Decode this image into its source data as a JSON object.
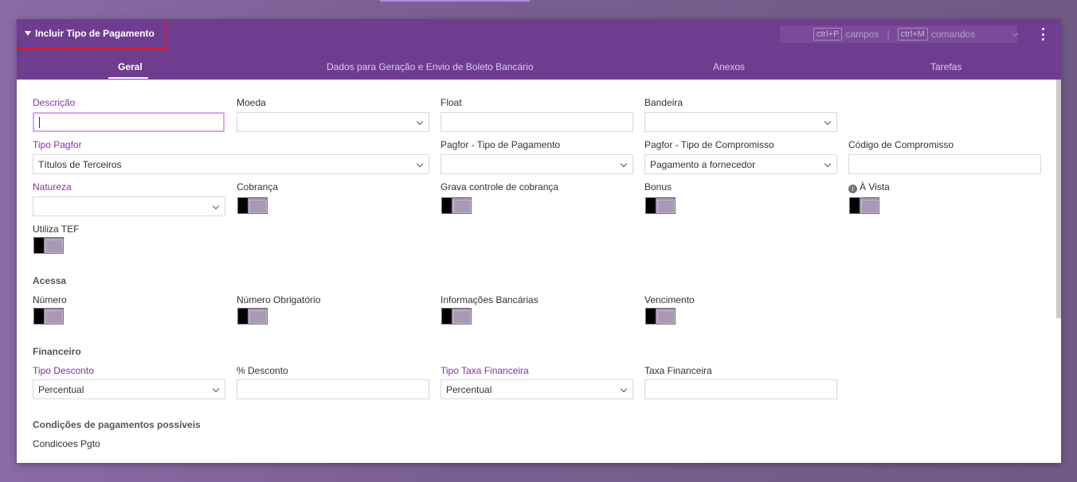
{
  "header": {
    "title": "Incluir Tipo de Pagamento",
    "shortcut_fields_key": "ctrl+P",
    "shortcut_fields_label": "campos",
    "shortcut_separator": "|",
    "shortcut_commands_key": "ctrl+M",
    "shortcut_commands_label": "comandos"
  },
  "tabs": [
    {
      "label": "Geral"
    },
    {
      "label": "Dados para Geração e Envio de Boleto Bancário"
    },
    {
      "label": "Anexos"
    },
    {
      "label": "Tarefas"
    }
  ],
  "form": {
    "descricao": {
      "label": "Descrição",
      "value": ""
    },
    "moeda": {
      "label": "Moeda",
      "value": ""
    },
    "float": {
      "label": "Float",
      "value": ""
    },
    "bandeira": {
      "label": "Bandeira",
      "value": ""
    },
    "tipo_pagfor": {
      "label": "Tipo Pagfor",
      "value": "Títulos de Terceiros"
    },
    "pagfor_tipo_pagamento": {
      "label": "Pagfor - Tipo de Pagamento",
      "value": ""
    },
    "pagfor_tipo_compromisso": {
      "label": "Pagfor - Tipo de Compromisso",
      "value": "Pagamento a fornecedor"
    },
    "codigo_compromisso": {
      "label": "Código de Compromisso",
      "value": ""
    },
    "natureza": {
      "label": "Natureza",
      "value": ""
    },
    "cobranca": {
      "label": "Cobrança"
    },
    "grava_controle": {
      "label": "Grava controle de cobrança"
    },
    "bonus": {
      "label": "Bonus"
    },
    "a_vista": {
      "label": "À Vista"
    },
    "utiliza_tef": {
      "label": "Utiliza TEF"
    }
  },
  "acessa": {
    "title": "Acessa",
    "numero": {
      "label": "Número"
    },
    "numero_obrigatorio": {
      "label": "Número Obrigatório"
    },
    "informacoes_bancarias": {
      "label": "Informações Bancárias"
    },
    "vencimento": {
      "label": "Vencimento"
    }
  },
  "financeiro": {
    "title": "Financeiro",
    "tipo_desconto": {
      "label": "Tipo Desconto",
      "value": "Percentual"
    },
    "perc_desconto": {
      "label": "% Desconto",
      "value": ""
    },
    "tipo_taxa": {
      "label": "Tipo Taxa Financeira",
      "value": "Percentual"
    },
    "taxa": {
      "label": "Taxa Financeira",
      "value": ""
    }
  },
  "condicoes": {
    "title": "Condições de pagamentos possíveis",
    "grid_label": "Condicoes Pgto"
  }
}
